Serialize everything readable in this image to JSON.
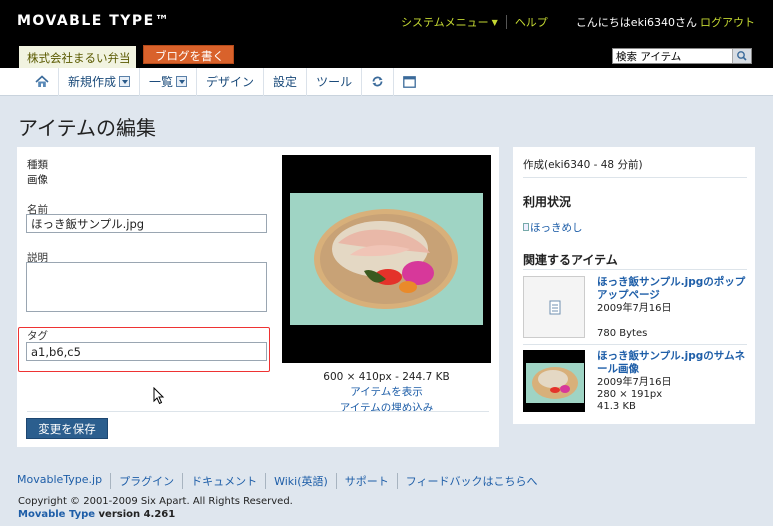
{
  "header": {
    "logo": "MOVABLE TYPE™",
    "system_menu": "システムメニュー",
    "help": "ヘルプ",
    "greeting": "こんにちはeki6340さん",
    "logout": "ログアウト",
    "blog_name": "株式会社まるい弁当",
    "write_blog": "ブログを書く",
    "search_value": "検索 アイテム"
  },
  "menu": {
    "new": "新規作成",
    "list": "一覧",
    "design": "デザイン",
    "settings": "設定",
    "tools": "ツール"
  },
  "page": {
    "title": "アイテムの編集"
  },
  "form": {
    "type_label": "種類",
    "type_value": "画像",
    "name_label": "名前",
    "name_value": "ほっき飯サンプル.jpg",
    "desc_label": "説明",
    "desc_value": "",
    "tags_label": "タグ",
    "tags_value": "a1,b6,c5",
    "save": "変更を保存"
  },
  "image": {
    "dimensions": "600 × 410px - 244.7 KB",
    "view_link": "アイテムを表示",
    "embed_link": "アイテムの埋め込み"
  },
  "side": {
    "created": "作成(eki6340 - 48 分前)",
    "usage_head": "利用状況",
    "usage_link": "ほっきめし",
    "related_head": "関連するアイテム",
    "related": [
      {
        "title": "ほっき飯サンプル.jpgのポップアップページ",
        "date": "2009年7月16日",
        "size": "780 Bytes"
      },
      {
        "title": "ほっき飯サンプル.jpgのサムネール画像",
        "date": "2009年7月16日",
        "dims": "280 × 191px",
        "size": "41.3 KB"
      }
    ]
  },
  "footer": {
    "links": [
      "MovableType.jp",
      "プラグイン",
      "ドキュメント",
      "Wiki(英語)",
      "サポート",
      "フィードバックはこちらへ"
    ],
    "copyright": "Copyright © 2001-2009 Six Apart. All Rights Reserved.",
    "product": "Movable Type",
    "version": " version 4.261"
  },
  "colors": {
    "accent_link": "#1e5ea8",
    "header_bg": "#000000",
    "write_button": "#d9622b",
    "highlight_box": "#ee3333"
  }
}
